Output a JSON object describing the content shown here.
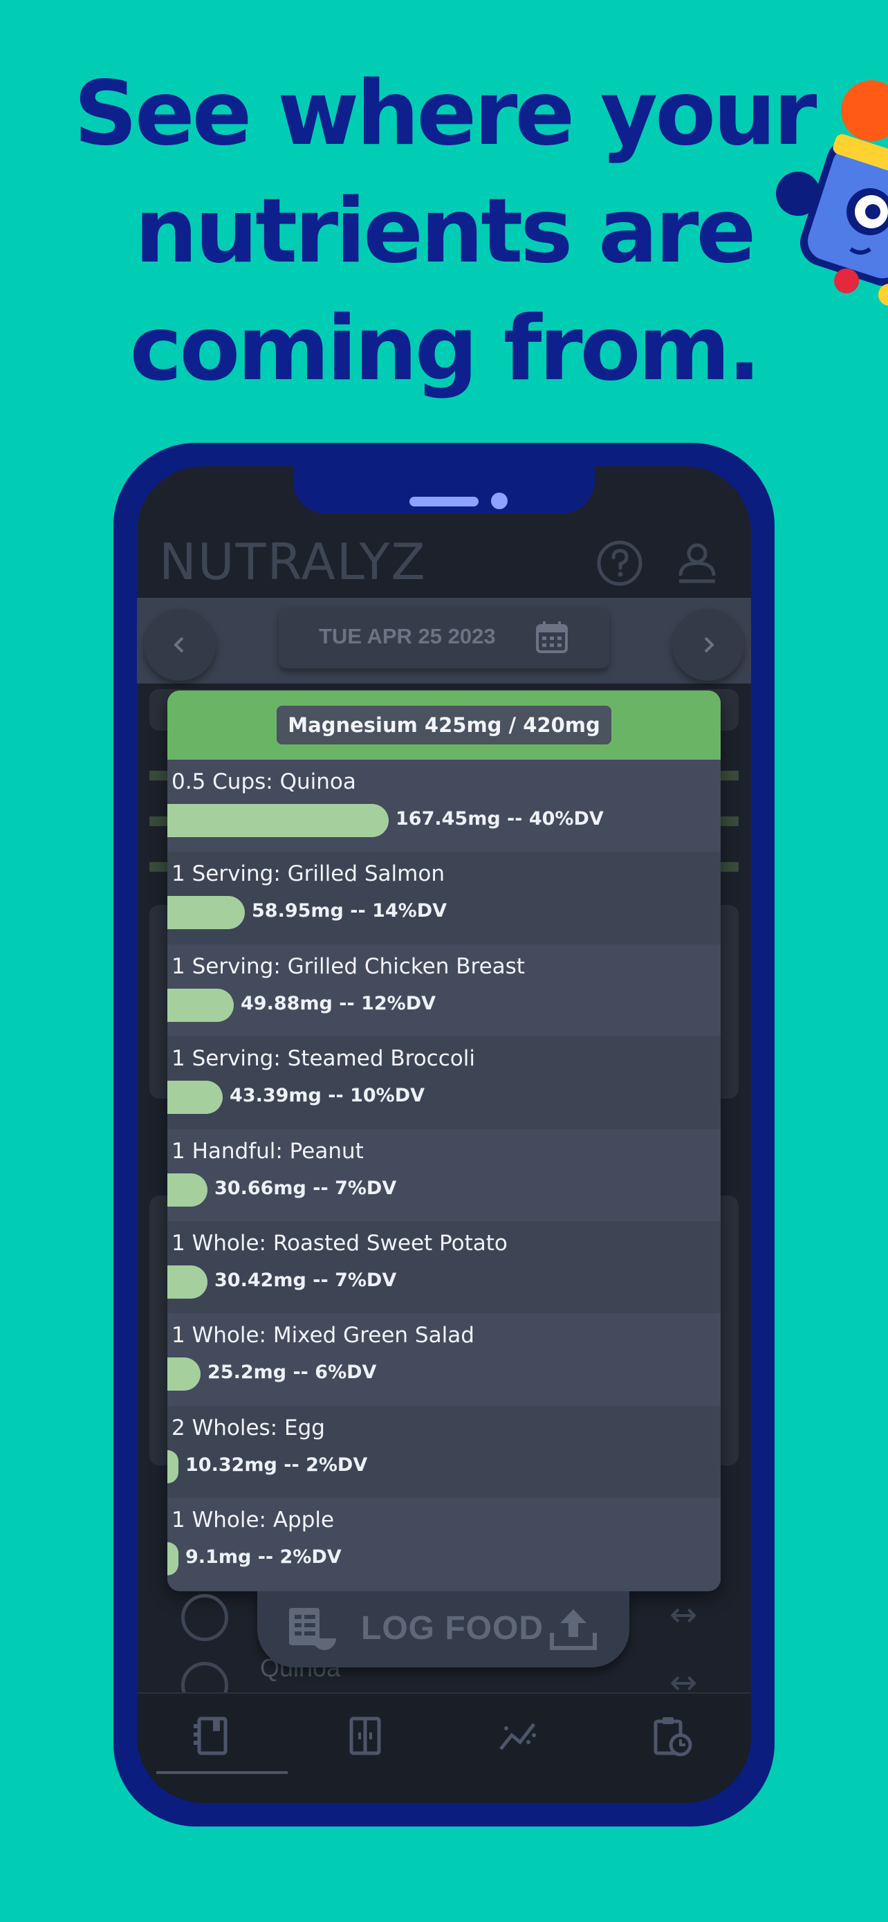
{
  "headline": {
    "line1": "See where your",
    "line2": "nutrients are",
    "line3": "coming from."
  },
  "app": {
    "title": "NUTRALYZ",
    "date": "TUE APR 25 2023"
  },
  "modal": {
    "title": "Magnesium 425mg / 420mg",
    "rows": [
      {
        "label": "0.5 Cups: Quinoa",
        "value": "167.45mg -- 40%DV",
        "dv_percent": 40
      },
      {
        "label": "1 Serving: Grilled Salmon",
        "value": "58.95mg -- 14%DV",
        "dv_percent": 14
      },
      {
        "label": "1 Serving: Grilled Chicken Breast",
        "value": "49.88mg -- 12%DV",
        "dv_percent": 12
      },
      {
        "label": "1 Serving: Steamed Broccoli",
        "value": "43.39mg -- 10%DV",
        "dv_percent": 10
      },
      {
        "label": "1 Handful: Peanut",
        "value": "30.66mg -- 7%DV",
        "dv_percent": 7
      },
      {
        "label": "1 Whole: Roasted Sweet Potato",
        "value": "30.42mg -- 7%DV",
        "dv_percent": 7
      },
      {
        "label": "1 Whole: Mixed Green Salad",
        "value": "25.2mg -- 6%DV",
        "dv_percent": 6
      },
      {
        "label": "2 Wholes: Egg",
        "value": "10.32mg -- 2%DV",
        "dv_percent": 2
      },
      {
        "label": "1 Whole: Apple",
        "value": "9.1mg -- 2%DV",
        "dv_percent": 2
      }
    ]
  },
  "log_food": {
    "label": "LOG FOOD"
  },
  "background": {
    "food_item": "Quinoa"
  },
  "colors": {
    "background": "#00cdb4",
    "headline": "#0e1f8e",
    "phone_frame": "#0c1d80",
    "modal_header": "#6ab466",
    "bar": "#a6cf9e"
  },
  "icons": {
    "help": "help-circle-icon",
    "profile": "profile-icon",
    "calendar": "calendar-icon",
    "log_food": "food-menu-icon",
    "upload": "upload-icon",
    "tabs": [
      "journal-icon",
      "pantry-icon",
      "trends-icon",
      "history-icon"
    ]
  }
}
